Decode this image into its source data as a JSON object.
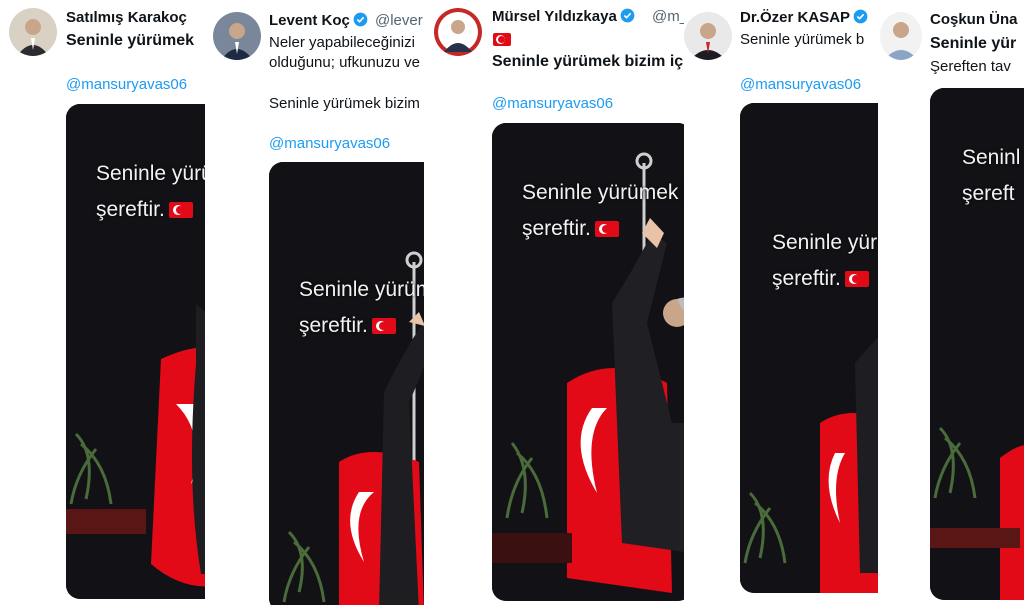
{
  "strips": [
    {
      "author": "Satılmış Karakoç",
      "text": "Seninle yürümek",
      "mention": "@mansuryavas06",
      "caption_line1": "Seninle yürü",
      "caption_line2": "şereftir."
    },
    {
      "author": "Levent Koç",
      "handle": "@lever",
      "text_line1": "Neler yapabileceğinizi",
      "text_line2": "olduğunu; ufkunuzu ve",
      "text_line3": "Seninle yürümek bizim",
      "mention": "@mansuryavas06",
      "caption_line1": "Seninle yürüm",
      "caption_line2": "şereftir."
    },
    {
      "author": "Mürsel Yıldızkaya",
      "handle": "@m_",
      "text": "Seninle yürümek bizim iç",
      "mention": "@mansuryavas06",
      "caption_line1": "Seninle yürümek b",
      "caption_line2": "şereftir."
    },
    {
      "author": "Dr.Özer KASAP",
      "text": "Seninle yürümek b",
      "mention": "@mansuryavas06",
      "caption_line1": "Seninle yür",
      "caption_line2": "şereftir."
    },
    {
      "author": "Coşkun Üna",
      "text_line1": "Seninle yür",
      "text_line2": "Şereften tav",
      "caption_line1": "Seninl",
      "caption_line2": "şereft"
    }
  ],
  "colors": {
    "mention": "#1d9bf0",
    "verified": "#1d9bf0",
    "flag": "#e30a17",
    "media_bg": "#141418"
  },
  "icons": [
    "verified-badge-icon",
    "turkish-flag-emoji",
    "avatar-photo"
  ]
}
